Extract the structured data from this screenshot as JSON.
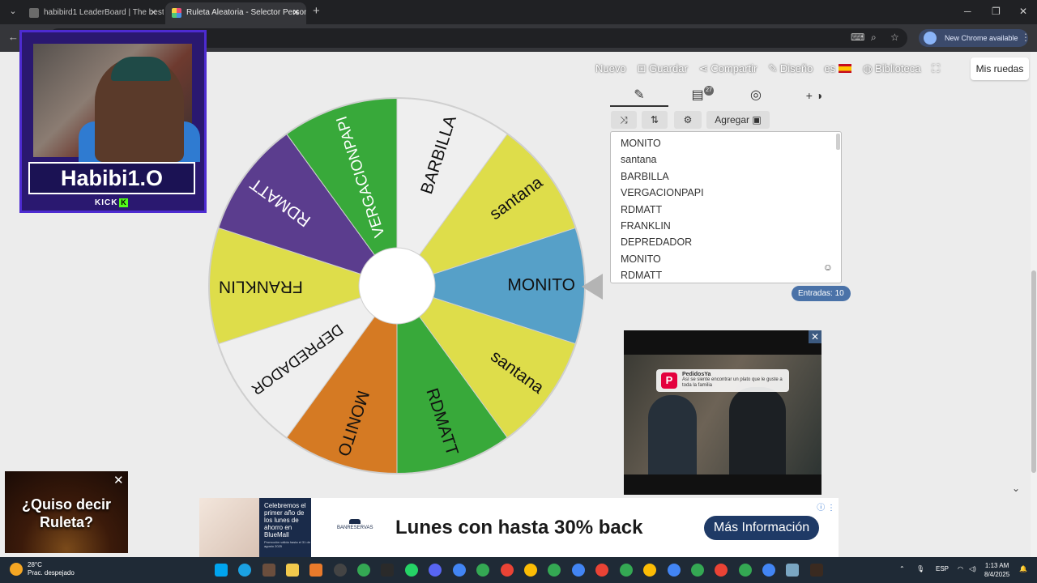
{
  "browser": {
    "tabs": [
      {
        "label": "habibird1 LeaderBoard | The best",
        "favicon_color": "#6b6b6b"
      },
      {
        "label": "Ruleta Aleatoria - Selector Personal",
        "favicon_color": "#e94e77"
      }
    ],
    "new_chrome_label": "New Chrome available"
  },
  "toplinks": {
    "nuevo": "Nuevo",
    "guardar": "Guardar",
    "compartir": "Compartir",
    "diseno": "Diseño",
    "lang": "es",
    "biblioteca": "Biblioteca"
  },
  "mis_ruedas": "Mis ruedas",
  "panel": {
    "tab_badge": "27",
    "agregar_label": "Agregar",
    "entries": [
      "MONITO",
      "santana",
      "BARBILLA",
      "VERGACIONPAPI",
      "RDMATT",
      "FRANKLIN",
      "DEPREDADOR",
      "MONITO",
      "RDMATT"
    ],
    "entries_count_label": "Entradas: 10"
  },
  "wheel": {
    "segments": [
      {
        "label": "MONITO",
        "color": "#56a0c8",
        "text_color": "#111"
      },
      {
        "label": "santana",
        "color": "#dedd4a",
        "text_color": "#111"
      },
      {
        "label": "RDMATT",
        "color": "#38a93a",
        "text_color": "#111"
      },
      {
        "label": "MONITO",
        "color": "#d57a23",
        "text_color": "#111"
      },
      {
        "label": "DEPREDADOR",
        "color": "#efefef",
        "text_color": "#111"
      },
      {
        "label": "FRANKLIN",
        "color": "#dedd4a",
        "text_color": "#111"
      },
      {
        "label": "RDMATT",
        "color": "#5b3d8e",
        "text_color": "#ffffff"
      },
      {
        "label": "VERGACIONPAPI",
        "color": "#38a93a",
        "text_color": "#ffffff"
      },
      {
        "label": "BARBILLA",
        "color": "#efefef",
        "text_color": "#111"
      },
      {
        "label": "santana",
        "color": "#dedd4a",
        "text_color": "#111"
      }
    ]
  },
  "webcam": {
    "name": "Habibi1.O",
    "platform": "KICK"
  },
  "video_ad": {
    "brand": "PedidosYa",
    "message": "Así se siente encontrar un plato que le guste a toda la familia"
  },
  "roulette_ad": {
    "text": "¿Quiso decir Ruleta?"
  },
  "banner": {
    "promo_text": "Celebremos el primer año de los lunes de ahorro en BlueMall",
    "promo_fine": "Promoción válida hasta el 31 de agosto 2025",
    "brand": "BANRESERVAS",
    "headline": "Lunes con hasta 30% back",
    "cta": "Más Información"
  },
  "taskbar": {
    "temp": "28°C",
    "weather": "Prac. despejado",
    "lang": "ESP",
    "time": "1:13 AM",
    "date": "8/4/2025"
  }
}
